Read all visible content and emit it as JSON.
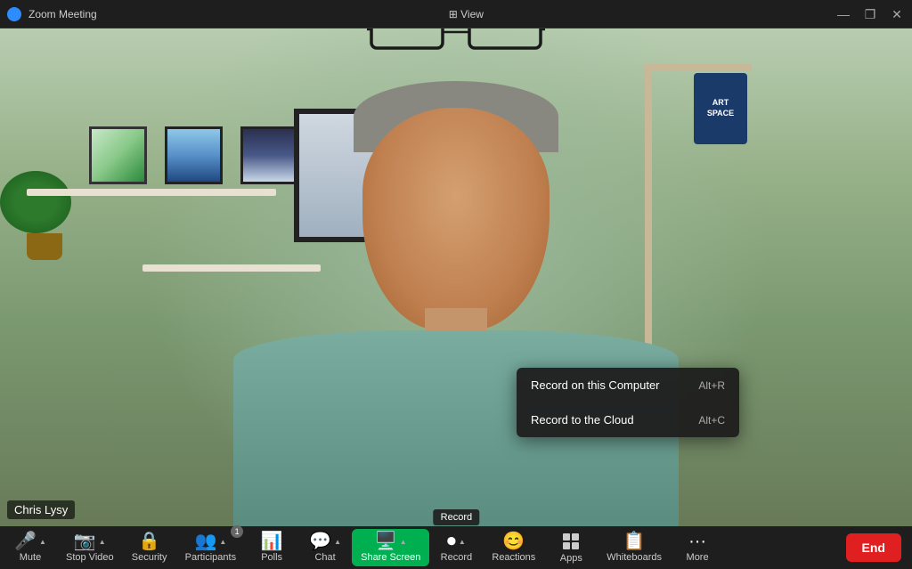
{
  "titleBar": {
    "title": "Zoom Meeting",
    "icon": "zoom-icon",
    "controls": {
      "minimize": "—",
      "maximize": "❐",
      "close": "✕"
    },
    "viewLabel": "⊞ View"
  },
  "participant": {
    "name": "Chris Lysy"
  },
  "recordDropdown": {
    "items": [
      {
        "label": "Record on this Computer",
        "shortcut": "Alt+R"
      },
      {
        "label": "Record to the Cloud",
        "shortcut": "Alt+C"
      }
    ]
  },
  "toolbar": {
    "items": [
      {
        "id": "mute",
        "label": "Mute",
        "icon": "mic-icon",
        "hasChevron": true
      },
      {
        "id": "stop-video",
        "label": "Stop Video",
        "icon": "video-icon",
        "hasChevron": true
      },
      {
        "id": "security",
        "label": "Security",
        "icon": "security-icon",
        "hasChevron": false
      },
      {
        "id": "participants",
        "label": "Participants",
        "icon": "participants-icon",
        "hasChevron": true,
        "badge": "1"
      },
      {
        "id": "polls",
        "label": "Polls",
        "icon": "polls-icon",
        "hasChevron": false
      },
      {
        "id": "chat",
        "label": "Chat",
        "icon": "chat-icon",
        "hasChevron": true
      },
      {
        "id": "share-screen",
        "label": "Share Screen",
        "icon": "screen-icon",
        "hasChevron": true,
        "isGreen": true
      },
      {
        "id": "record",
        "label": "Record",
        "icon": "record-icon",
        "hasChevron": true,
        "hasTooltip": true,
        "tooltip": "Record"
      },
      {
        "id": "reactions",
        "label": "Reactions",
        "icon": "reactions-icon",
        "hasChevron": false
      },
      {
        "id": "apps",
        "label": "Apps",
        "icon": "apps-icon",
        "hasChevron": false
      },
      {
        "id": "whiteboards",
        "label": "Whiteboards",
        "icon": "whiteboards-icon",
        "hasChevron": false
      },
      {
        "id": "more",
        "label": "More",
        "icon": "more-icon",
        "hasChevron": false
      }
    ],
    "endButton": "End"
  },
  "colors": {
    "toolbarBg": "#1e1e1e",
    "titleBarBg": "#1e1e1e",
    "shareScreenGreen": "#00b050",
    "endButtonRed": "#e02020",
    "dropdownBg": "rgba(30,30,30,0.95)"
  }
}
